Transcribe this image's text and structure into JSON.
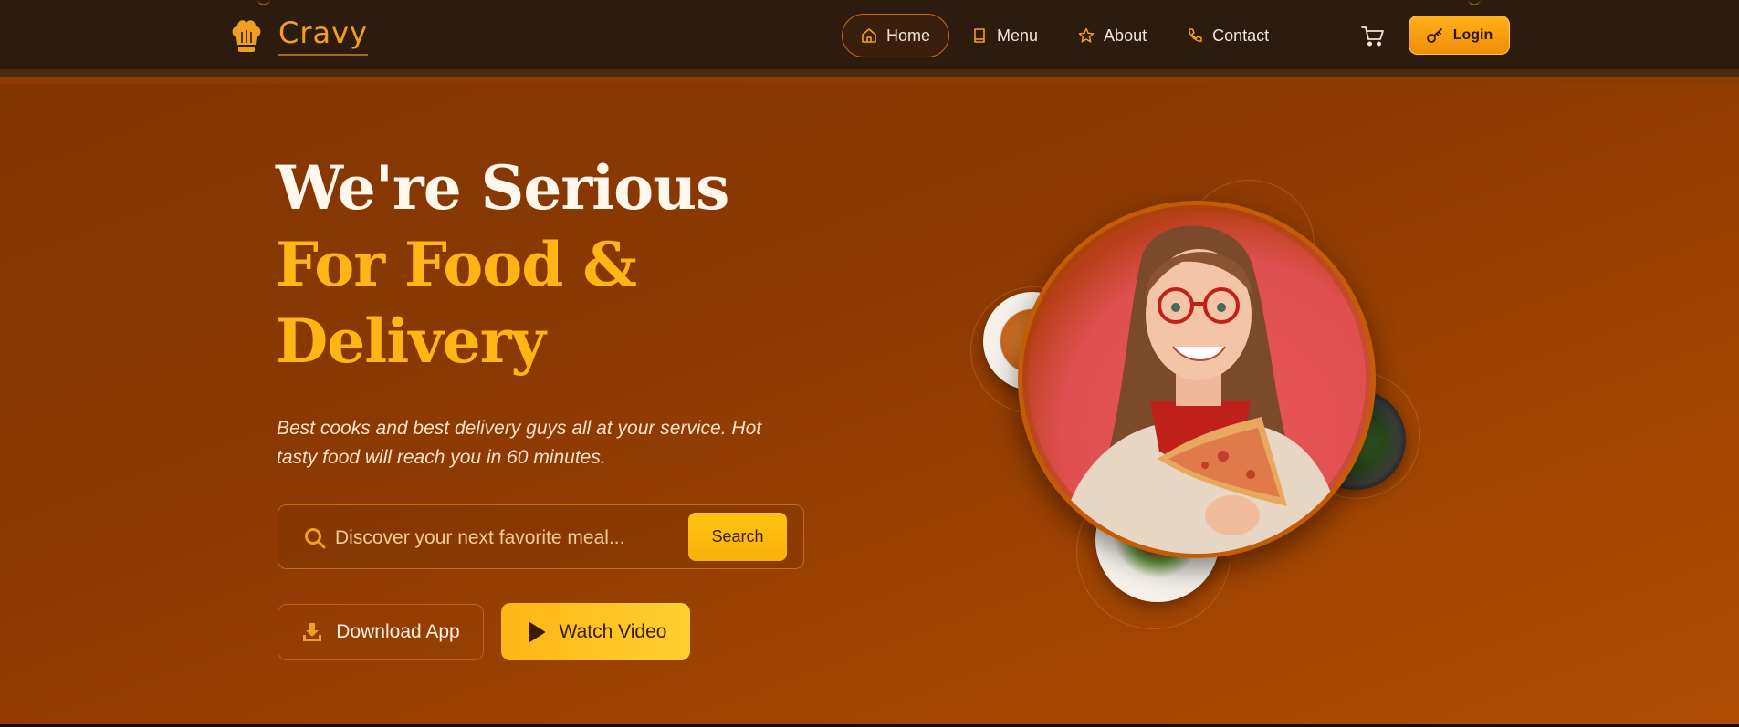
{
  "brand": {
    "name": "Cravy"
  },
  "nav": {
    "items": [
      {
        "label": "Home",
        "icon": "home-icon",
        "active": true
      },
      {
        "label": "Menu",
        "icon": "book-icon",
        "active": false
      },
      {
        "label": "About",
        "icon": "star-icon",
        "active": false
      },
      {
        "label": "Contact",
        "icon": "phone-icon",
        "active": false
      }
    ],
    "cart_icon": "cart-icon",
    "login_label": "Login"
  },
  "hero": {
    "headline_line1": "We're Serious",
    "headline_line2": "For Food &",
    "headline_line3": "Delivery",
    "subtext": "Best cooks and best delivery guys all at your service. Hot tasty food will reach you in 60 minutes.",
    "search": {
      "placeholder": "Discover your next favorite meal...",
      "button_label": "Search"
    },
    "download_label": "Download App",
    "watch_label": "Watch Video"
  },
  "colors": {
    "nav_bg": "#2d1b0e",
    "hero_bg": "#8c3902",
    "accent": "#ffb514",
    "accent_orange": "#f08c05"
  }
}
